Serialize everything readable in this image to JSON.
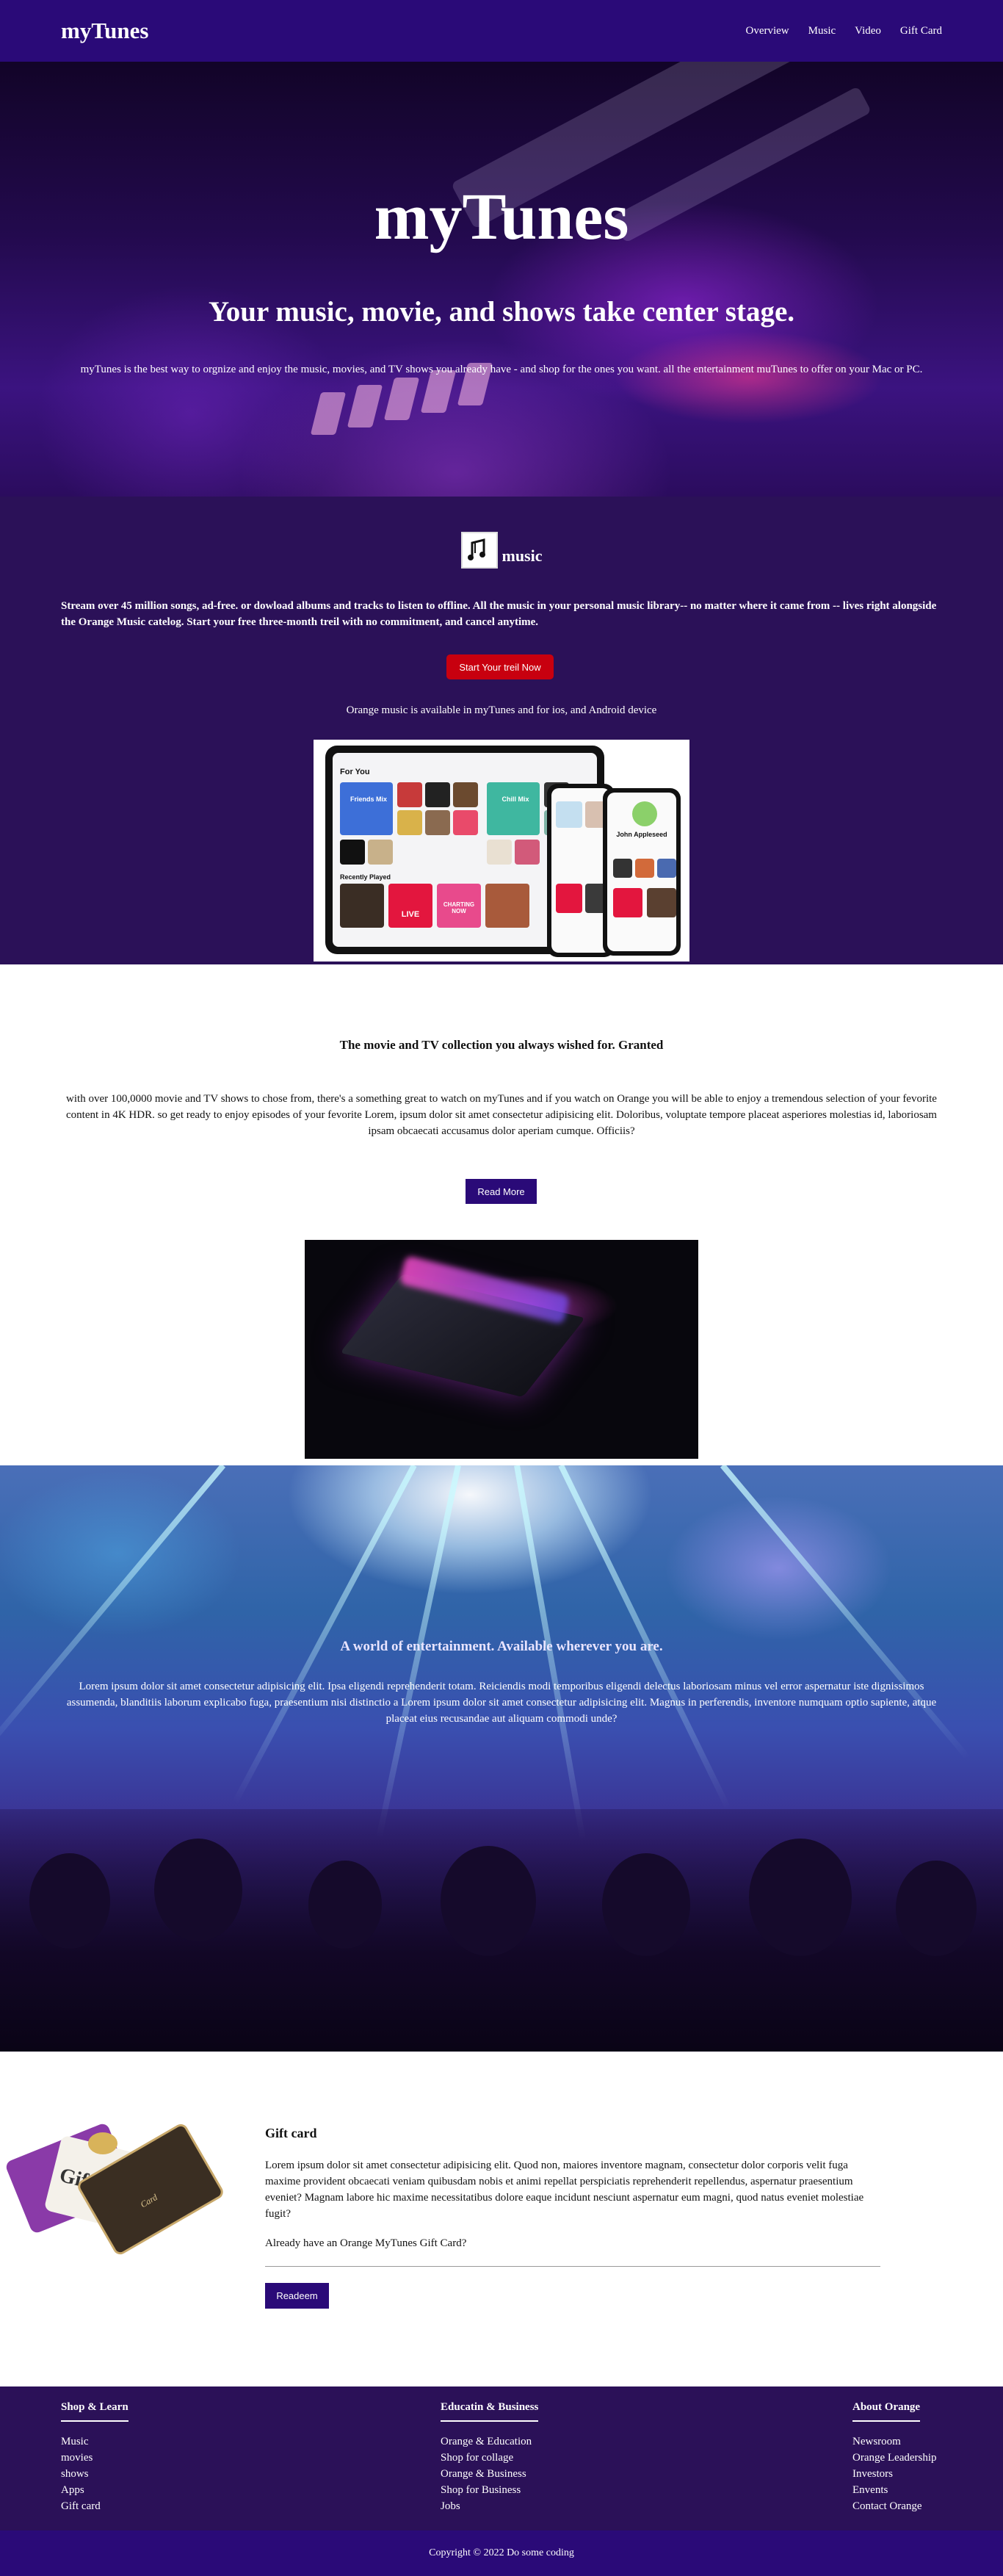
{
  "nav": {
    "brand": "myTunes",
    "links": [
      "Overview",
      "Music",
      "Video",
      "Gift Card"
    ]
  },
  "hero": {
    "title": "myTunes",
    "subtitle": "Your music, movie, and shows take center stage.",
    "text": "myTunes is the best way to orgnize and enjoy the music, movies, and TV shows you already have - and shop for the ones you want. all the entertainment muTunes to offer on your Mac or PC."
  },
  "music": {
    "heading": "music",
    "description": "Stream over 45 million songs, ad-free. or dowload albums and tracks to listen to offline. All the music in your personal music library-- no matter where it came from -- lives right alongside the Orange Music catelog. Start your free three-month treil with no commitment, and cancel anytime.",
    "trial_button": "Start Your treil Now",
    "availability": "Orange music is available in myTunes and for ios, and Android device",
    "device_screen": {
      "for_you": "For You",
      "friends_mix": "Friends Mix",
      "chill_mix": "Chill Mix",
      "recently_played": "Recently Played",
      "live_badge": "LIVE",
      "charting_now": "CHARTING NOW",
      "profile_name": "John Appleseed"
    }
  },
  "movie": {
    "title": "The movie and TV collection you always wished for. Granted",
    "text": "with over 100,0000 movie and TV shows to chose from, there's a something great to watch on myTunes and if you watch on Orange you will be able to enjoy a tremendous selection of your fevorite content in 4K HDR. so get ready to enjoy episodes of your fevorite Lorem, ipsum dolor sit amet consectetur adipisicing elit. Doloribus, voluptate tempore placeat asperiores molestias id, laboriosam ipsam obcaecati accusamus dolor aperiam cumque. Officiis?",
    "read_more": "Read More"
  },
  "concert": {
    "title": "A world of entertainment. Available wherever you are.",
    "text": "Lorem ipsum dolor sit amet consectetur adipisicing elit. Ipsa eligendi reprehenderit totam. Reiciendis modi temporibus eligendi delectus laboriosam minus vel error aspernatur iste dignissimos assumenda, blanditiis laborum explicabo fuga, praesentium nisi distinctio a Lorem ipsum dolor sit amet consectetur adipisicing elit. Magnus in perferendis, inventore numquam optio sapiente, atque placeat eius recusandae aut aliquam commodi unde?"
  },
  "gift": {
    "title": "Gift card",
    "text": "Lorem ipsum dolor sit amet consectetur adipisicing elit. Quod non, maiores inventore magnam, consectetur dolor corporis velit fuga maxime provident obcaecati veniam quibusdam nobis et animi repellat perspiciatis reprehenderit repellendus, aspernatur praesentium eveniet? Magnam labore hic maxime necessitatibus dolore eaque incidunt nesciunt aspernatur eum magni, quod natus eveniet molestiae fugit?",
    "question": "Already have an Orange MyTunes Gift Card?",
    "redeem": "Readeem",
    "card_labels": {
      "gift": "Gift",
      "card": "Card"
    }
  },
  "footer": {
    "columns": [
      {
        "title": "Shop & Learn",
        "items": [
          "Music",
          "movies",
          "shows",
          "Apps",
          "Gift card"
        ]
      },
      {
        "title": "Educatin & Business",
        "items": [
          "Orange & Education",
          "Shop for collage",
          "Orange & Business",
          "Shop for Business",
          "Jobs"
        ]
      },
      {
        "title": "About Orange",
        "items": [
          "Newsroom",
          "Orange Leadership",
          "Investors",
          "Envents",
          "Contact Orange"
        ]
      }
    ],
    "copyright": "Copyright © 2022 Do some coding"
  },
  "colors": {
    "nav_bg": "#2a0a78",
    "section_bg": "#2b1158",
    "trial_button": "#c8000f",
    "primary_button": "#2a0a78"
  }
}
